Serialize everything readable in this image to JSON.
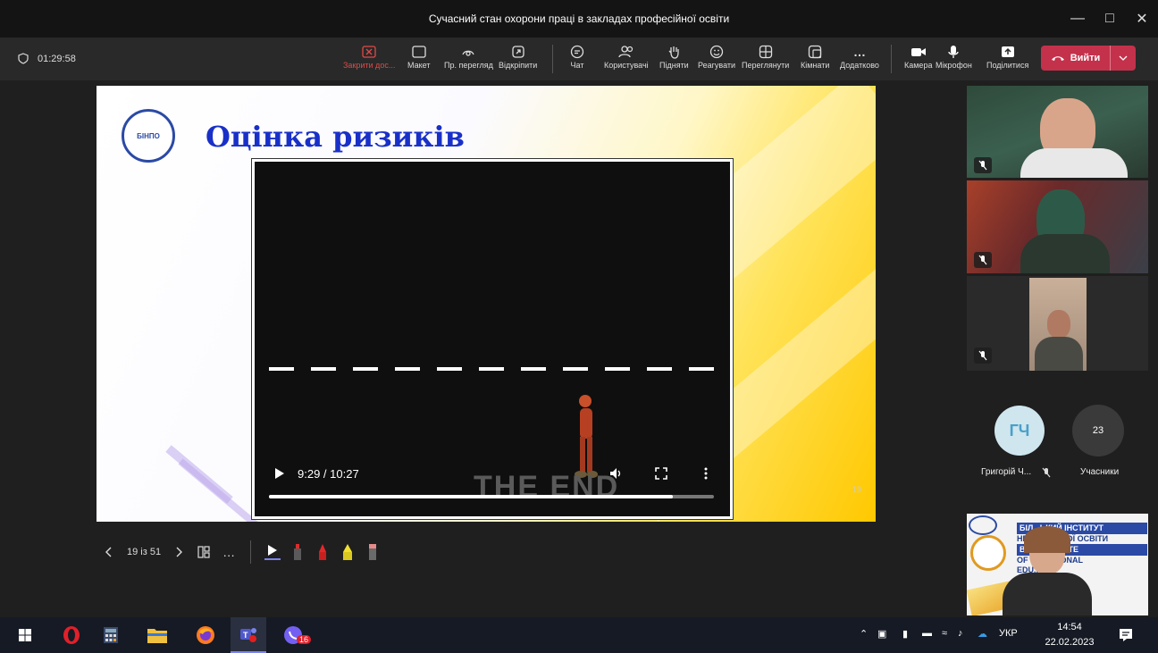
{
  "window": {
    "title": "Сучасний стан охорони праці в закладах професійної освіти"
  },
  "meeting": {
    "timer": "01:29:58",
    "toolbar": {
      "stop_sharing": "Закрити дос...",
      "layout": "Макет",
      "view": "Пр. перегляд",
      "popout": "Відкріпити",
      "chat": "Чат",
      "people": "Користувачі",
      "raise_hand": "Підняти",
      "react": "Реагувати",
      "view_mode": "Переглянути",
      "rooms": "Кімнати",
      "more": "Додатково",
      "camera": "Камера",
      "mic": "Мікрофон",
      "share": "Поділитися",
      "leave": "Вийти"
    }
  },
  "slide": {
    "title": "Оцінка ризиків",
    "number": "19",
    "logo_text": "БІНПО"
  },
  "video": {
    "time": "9:29 / 10:27",
    "progress": 0.908,
    "overlay_text": "THE END"
  },
  "slide_nav": {
    "page": "19 із 51"
  },
  "participants": {
    "avatar_initials": "ГЧ",
    "avatar_name": "Григорій Ч...",
    "count": "23",
    "count_label": "Учасники",
    "presenter_banner": {
      "line1": "БІЛ...ЬКИЙ ІНСТИТУТ",
      "line2": "НЕ...ФЕСІЙНОЇ ОСВІТИ",
      "line3": "BIL...NSTITUTE",
      "line4": "OF ...FESSIONAL",
      "line5": "EDU..."
    }
  },
  "taskbar": {
    "teams_badge": "16",
    "lang": "УКР",
    "time": "14:54",
    "date": "22.02.2023"
  }
}
